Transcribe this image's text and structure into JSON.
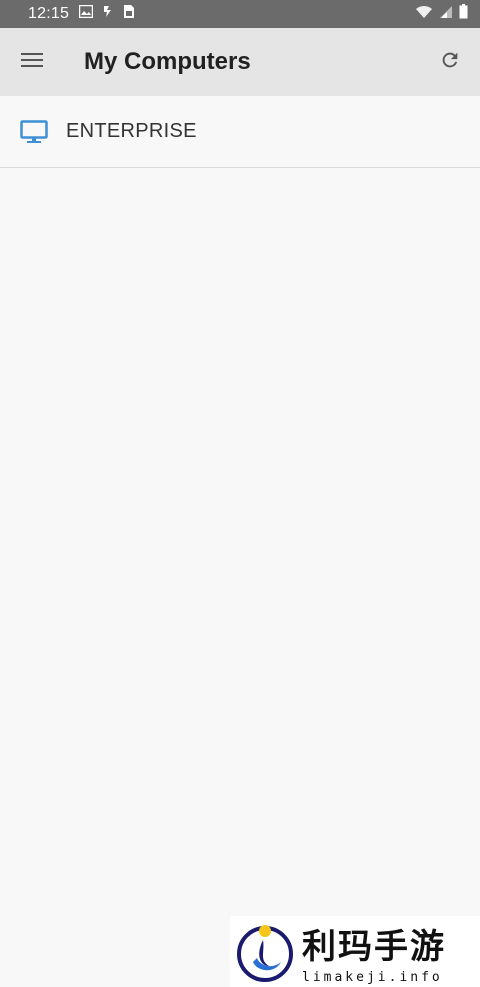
{
  "status_bar": {
    "time": "12:15",
    "left_icons": [
      "image-icon",
      "lightning-icon",
      "sim-card-icon"
    ],
    "right_icons": [
      "wifi-icon",
      "signal-icon",
      "battery-icon"
    ]
  },
  "app_bar": {
    "menu_icon": "hamburger-menu-icon",
    "title": "My Computers",
    "refresh_icon": "refresh-icon"
  },
  "computers": [
    {
      "name": "ENTERPRISE",
      "icon": "monitor-icon",
      "icon_color": "#3d8fd6"
    }
  ],
  "watermark": {
    "text_cn": "利玛手游",
    "text_en": "limakeji.info"
  },
  "colors": {
    "status_bar": "#6b6b6b",
    "app_bar": "#e5e5e5",
    "background": "#f8f8f8",
    "accent": "#3d8fd6"
  }
}
